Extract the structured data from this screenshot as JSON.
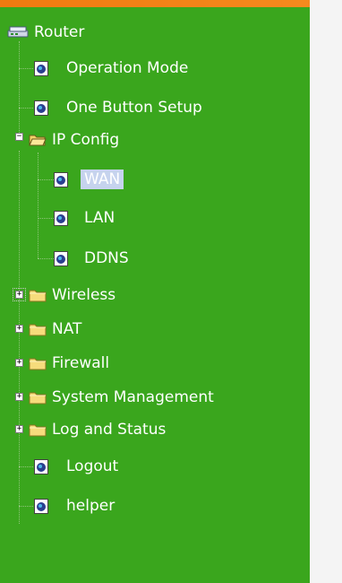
{
  "tree": {
    "root": {
      "label": "Router",
      "icon": "router-icon"
    },
    "items": [
      {
        "label": "Operation Mode",
        "type": "page",
        "icon": "page-icon"
      },
      {
        "label": "One Button Setup",
        "type": "page",
        "icon": "page-icon"
      },
      {
        "label": "IP Config",
        "type": "folder",
        "state": "expanded",
        "toggle": "−",
        "icon": "folder-open-icon",
        "children": [
          {
            "label": "WAN",
            "type": "page",
            "selected": true,
            "icon": "page-icon"
          },
          {
            "label": "LAN",
            "type": "page",
            "icon": "page-icon"
          },
          {
            "label": "DDNS",
            "type": "page",
            "icon": "page-icon"
          }
        ]
      },
      {
        "label": "Wireless",
        "type": "folder",
        "state": "collapsed",
        "toggle": "+",
        "icon": "folder-closed-icon"
      },
      {
        "label": "NAT",
        "type": "folder",
        "state": "collapsed",
        "toggle": "+",
        "icon": "folder-closed-icon"
      },
      {
        "label": "Firewall",
        "type": "folder",
        "state": "collapsed",
        "toggle": "+",
        "icon": "folder-closed-icon"
      },
      {
        "label": "System Management",
        "type": "folder",
        "state": "collapsed",
        "toggle": "+",
        "icon": "folder-closed-icon"
      },
      {
        "label": "Log and Status",
        "type": "folder",
        "state": "collapsed",
        "toggle": "+",
        "icon": "folder-closed-icon"
      },
      {
        "label": "Logout",
        "type": "page",
        "icon": "page-icon"
      },
      {
        "label": "helper",
        "type": "page",
        "icon": "page-icon"
      }
    ]
  },
  "colors": {
    "panel": "#3aa61d",
    "top_accent": "#f07a10",
    "selection": "#c6d3ee",
    "text": "#ffffff"
  }
}
